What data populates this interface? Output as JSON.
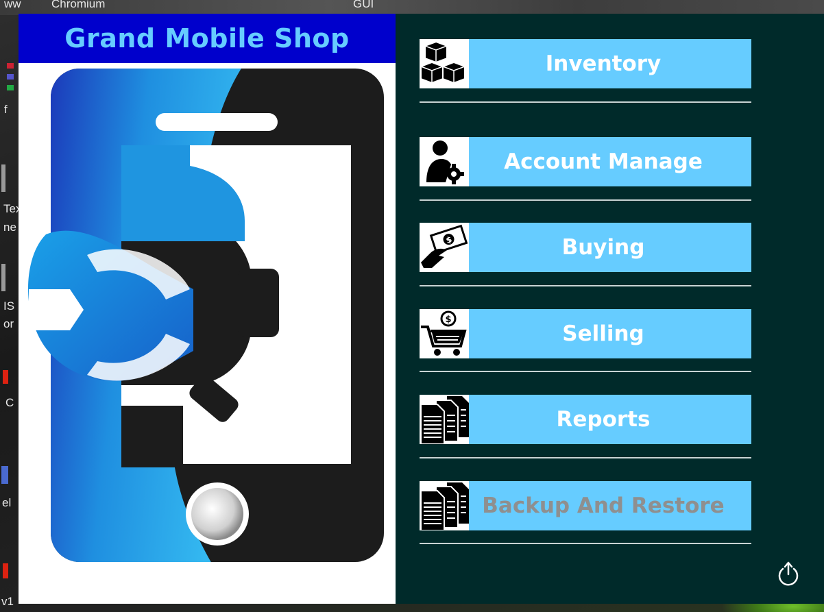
{
  "app": {
    "title": "Grand Mobile Shop"
  },
  "desktop": {
    "top_labels": [
      "ww",
      "Chromium",
      "GUI"
    ],
    "side_labels": [
      "f",
      "Tex",
      "ne",
      "IS",
      "or",
      "C",
      "el",
      "v1"
    ]
  },
  "menu": {
    "items": [
      {
        "label": "Inventory",
        "icon": "boxes-icon",
        "enabled": true
      },
      {
        "label": "Account Manage",
        "icon": "user-gear-icon",
        "enabled": true
      },
      {
        "label": "Buying",
        "icon": "money-hand-icon",
        "enabled": true
      },
      {
        "label": "Selling",
        "icon": "shopping-cart-icon",
        "enabled": true
      },
      {
        "label": "Reports",
        "icon": "documents-icon",
        "enabled": true
      },
      {
        "label": "Backup And Restore",
        "icon": "documents-icon",
        "enabled": false
      }
    ]
  },
  "colors": {
    "title_bg": "#0000cc",
    "title_text": "#66ccff",
    "panel_bg": "#002a2a",
    "button_bg": "#66ccff",
    "button_text": "#ffffff",
    "disabled_text": "#8f8f8f"
  },
  "footer": {
    "power_icon": "power-icon"
  }
}
